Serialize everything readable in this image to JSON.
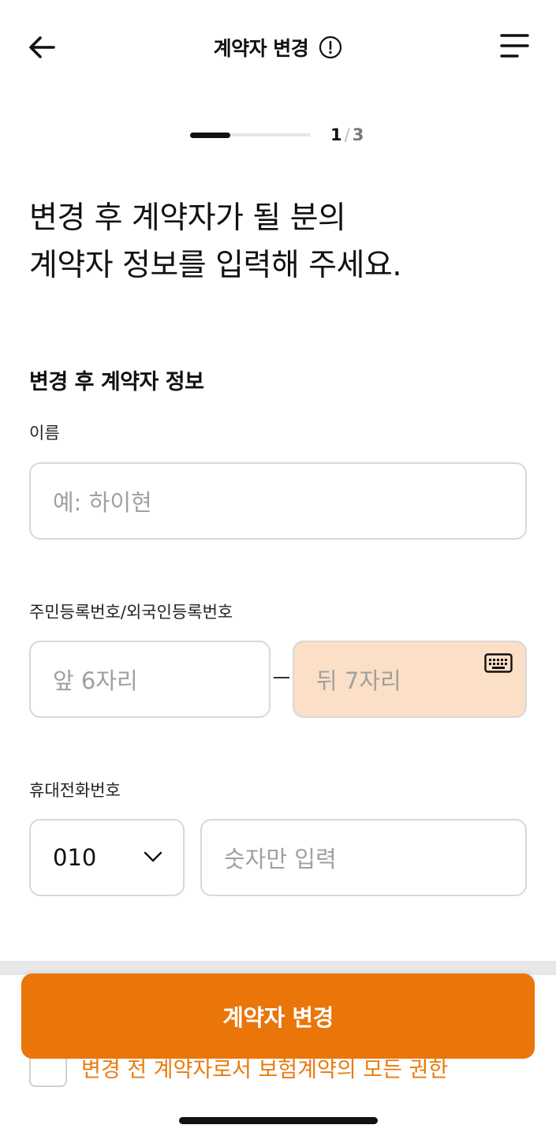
{
  "header": {
    "title": "계약자 변경",
    "back_icon": "arrow-left-icon",
    "info_icon": "exclamation-circle-icon",
    "menu_icon": "menu-icon"
  },
  "progress": {
    "current": "1",
    "separator": "/",
    "total": "3",
    "fraction": 0.333
  },
  "headline": {
    "line1": "변경 후 계약자가 될 분의",
    "line2": "계약자 정보를 입력해 주세요."
  },
  "section": {
    "title": "변경 후 계약자 정보"
  },
  "name_field": {
    "label": "이름",
    "placeholder": "예: 하이현"
  },
  "rrn_field": {
    "label": "주민등록번호/외국인등록번호",
    "front_placeholder": "앞 6자리",
    "back_placeholder": "뒤 7자리",
    "keyboard_icon": "keyboard-icon"
  },
  "phone_field": {
    "label": "휴대전화번호",
    "prefix_value": "010",
    "number_placeholder": "숫자만 입력"
  },
  "consent": {
    "text": "변경 전 계약자로서 보험계약의 모든 권한"
  },
  "primary_button": {
    "label": "계약자 변경"
  },
  "colors": {
    "accent": "#ea7508",
    "highlight_input": "#fbdfc6",
    "consent_text": "#ea7a0c"
  }
}
